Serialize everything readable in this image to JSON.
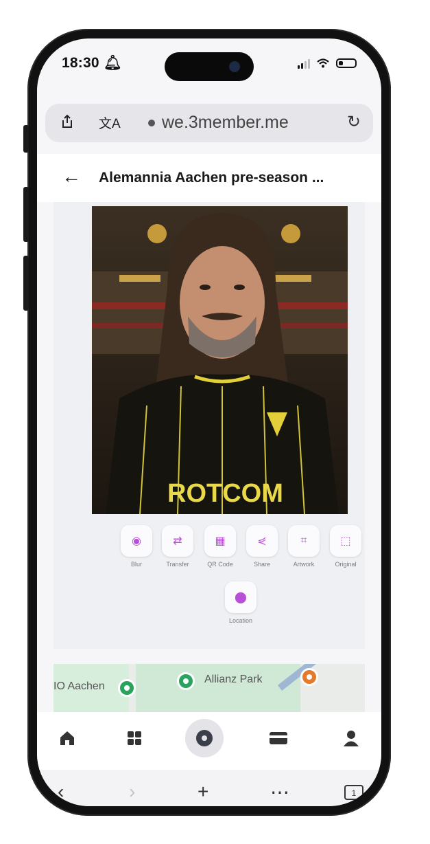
{
  "status_bar": {
    "time": "18:30"
  },
  "browser": {
    "url": "we.3member.me",
    "tabs_count": "1",
    "toolbar_icons": [
      "back-icon",
      "forward-icon",
      "plus-icon",
      "more-icon",
      "tabs-icon"
    ]
  },
  "page": {
    "title": "Alemannia Aachen pre-season ...",
    "photo_shirt_text": "ROTCOM"
  },
  "actions": [
    {
      "label": "Blur",
      "icon": "eye-icon"
    },
    {
      "label": "Transfer",
      "icon": "transfer-icon"
    },
    {
      "label": "QR Code",
      "icon": "qr-code-icon"
    },
    {
      "label": "Share",
      "icon": "share-icon"
    },
    {
      "label": "Artwork",
      "icon": "artwork-icon"
    },
    {
      "label": "Original",
      "icon": "original-icon"
    },
    {
      "label": "Location",
      "icon": "location-pin-icon"
    }
  ],
  "map": {
    "label_left": "IO Aachen",
    "label_right": "Allianz Park"
  },
  "bottom_nav": [
    "home-icon",
    "grid-icon",
    "center-action-icon",
    "card-icon",
    "profile-icon"
  ],
  "colors": {
    "accent": "#b84fd6",
    "map_pin": "#2aa35e"
  }
}
